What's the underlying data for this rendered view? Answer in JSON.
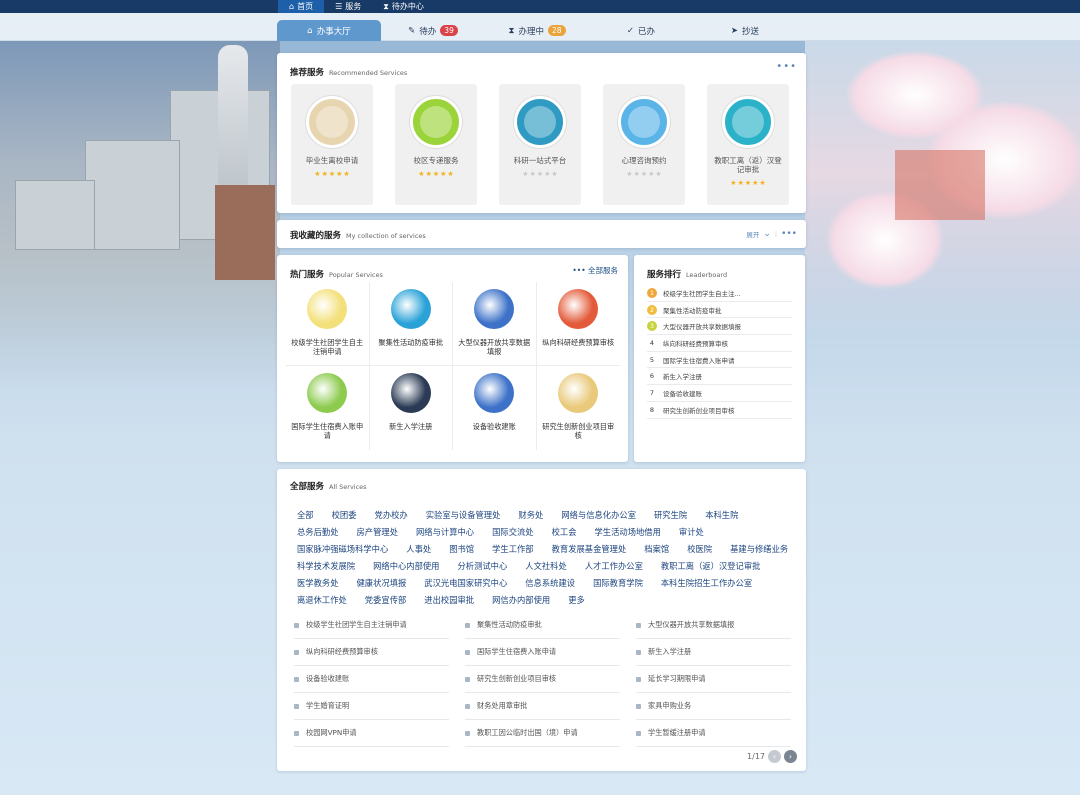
{
  "topnav": [
    {
      "label": "首页",
      "icon": "home-icon"
    },
    {
      "label": "服务",
      "icon": "list-icon"
    },
    {
      "label": "待办中心",
      "icon": "hourglass-icon"
    }
  ],
  "tabs": [
    {
      "label": "办事大厅",
      "icon": "home-icon"
    },
    {
      "label": "待办",
      "icon": "edit-icon",
      "badge": "39"
    },
    {
      "label": "办理中",
      "icon": "hourglass-icon",
      "badge": "28"
    },
    {
      "label": "已办",
      "icon": "check-circle-icon"
    },
    {
      "label": "抄送",
      "icon": "send-icon"
    }
  ],
  "recommended": {
    "title": "推荐服务",
    "subtitle": "Recommended Services",
    "more": "•••",
    "items": [
      {
        "name": "毕业生离校申请",
        "rating": 5,
        "icon": "graduate-icon",
        "color": "#e7d5b0"
      },
      {
        "name": "校区专递服务",
        "rating": 5,
        "icon": "mail-icon",
        "color": "#9bd43a"
      },
      {
        "name": "科研一站式平台",
        "rating": 0,
        "icon": "research-icon",
        "color": "#2f9bc2"
      },
      {
        "name": "心理咨询预约",
        "rating": 0,
        "icon": "counselor-icon",
        "color": "#5ab4e8"
      },
      {
        "name": "教职工离（返）汉登记审批",
        "rating": 5,
        "icon": "plane-icon",
        "color": "#2bb2c9"
      }
    ]
  },
  "collection": {
    "title": "我收藏的服务",
    "subtitle": "My collection of services",
    "expand": "展开",
    "more": "•••"
  },
  "popular": {
    "title": "热门服务",
    "subtitle": "Popular Services",
    "all_link": "••• 全部服务",
    "items": [
      {
        "name": "校级学生社团学生自主注销申请",
        "icon": "globe-icon",
        "color": "#f3e07a"
      },
      {
        "name": "聚集性活动防疫审批",
        "icon": "atom-icon",
        "color": "#2aa2d8"
      },
      {
        "name": "大型仪器开放共享数据填报",
        "icon": "server-icon",
        "color": "#3d72c8"
      },
      {
        "name": "纵向科研经费预算审核",
        "icon": "document-icon",
        "color": "#e35b3a"
      },
      {
        "name": "国际学生住宿费入账申请",
        "icon": "payment-icon",
        "color": "#8ccb4e"
      },
      {
        "name": "新生入学注册",
        "icon": "cap-icon",
        "color": "#2b3b55"
      },
      {
        "name": "设备验收建账",
        "icon": "server-icon",
        "color": "#3d72c8"
      },
      {
        "name": "研究生创新创业项目审核",
        "icon": "coin-icon",
        "color": "#e9c97a"
      }
    ]
  },
  "leaderboard": {
    "title": "服务排行",
    "subtitle": "Leaderboard",
    "items": [
      {
        "rank": "1",
        "name": "校级学生社团学生自主注..."
      },
      {
        "rank": "2",
        "name": "聚集性活动防疫审批"
      },
      {
        "rank": "3",
        "name": "大型仪器开放共享数据填报"
      },
      {
        "rank": "4",
        "name": "纵向科研经费预算审核"
      },
      {
        "rank": "5",
        "name": "国际学生住宿费入账申请"
      },
      {
        "rank": "6",
        "name": "新生入学注册"
      },
      {
        "rank": "7",
        "name": "设备验收建账"
      },
      {
        "rank": "8",
        "name": "研究生创新创业项目审核"
      }
    ]
  },
  "all_services": {
    "title": "全部服务",
    "subtitle": "All Services",
    "categories": [
      "全部",
      "校团委",
      "党办校办",
      "实验室与设备管理处",
      "财务处",
      "网络与信息化办公室",
      "研究生院",
      "本科生院",
      "总务后勤处",
      "房产管理处",
      "网络与计算中心",
      "国际交流处",
      "校工会",
      "学生活动场地借用",
      "审计处",
      "国家脉冲强磁场科学中心",
      "人事处",
      "图书馆",
      "学生工作部",
      "教育发展基金管理处",
      "档案馆",
      "校医院",
      "基建与修缮业务",
      "科学技术发展院",
      "网络中心内部使用",
      "分析测试中心",
      "人文社科处",
      "人才工作办公室",
      "教职工离（返）汉登记审批",
      "医学教务处",
      "健康状况填报",
      "武汉光电国家研究中心",
      "信息系统建设",
      "国际教育学院",
      "本科生院招生工作办公室",
      "离退休工作处",
      "党委宣传部",
      "进出校园审批",
      "网信办内部使用",
      "更多"
    ],
    "services": [
      "校级学生社团学生自主注销申请",
      "聚集性活动防疫审批",
      "大型仪器开放共享数据填报",
      "纵向科研经费预算审核",
      "国际学生住宿费入账申请",
      "新生入学注册",
      "设备验收建账",
      "研究生创新创业项目审核",
      "延长学习期限申请",
      "学生婚育证明",
      "财务处用章审批",
      "家具申购业务",
      "校园网VPN申请",
      "教职工因公临时出国（境）申请",
      "学生暂缓注册申请"
    ],
    "pager": {
      "current": "1/17"
    }
  }
}
